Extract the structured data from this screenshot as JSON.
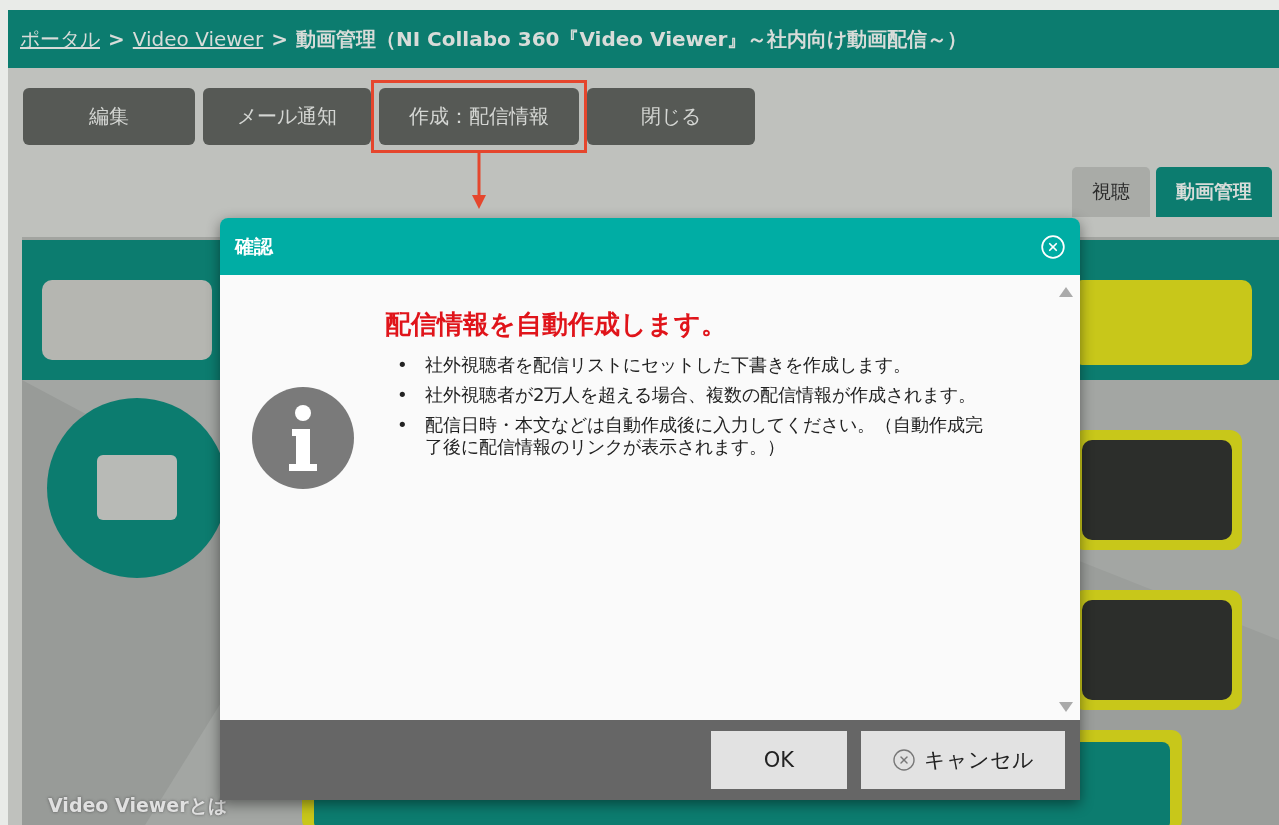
{
  "breadcrumb": [
    {
      "label": "ポータル",
      "kind": "link"
    },
    {
      "label": ">",
      "kind": "separator"
    },
    {
      "label": "Video Viewer",
      "kind": "link"
    },
    {
      "label": ">",
      "kind": "separator"
    },
    {
      "label": "動画管理（NI Collabo 360『Video Viewer』～社内向け動画配信～）",
      "kind": "current"
    }
  ],
  "toolbar": [
    {
      "label": "編集",
      "highlighted": false
    },
    {
      "label": "メール通知",
      "highlighted": false
    },
    {
      "label": "作成：配信情報",
      "highlighted": true
    },
    {
      "label": "閉じる",
      "highlighted": false
    }
  ],
  "view_tabs": [
    {
      "label": "視聴",
      "selected": false
    },
    {
      "label": "動画管理",
      "selected": true
    }
  ],
  "video": {
    "kind": "picture",
    "caption": "Video Viewerとは"
  },
  "dialog": {
    "title": "確認",
    "heading": "配信情報を自動作成します。",
    "bullets": [
      {
        "marker": "•",
        "text": "社外視聴者を配信リストにセットした下書きを作成します。"
      },
      {
        "marker": "•",
        "text": "社外視聴者が2万人を超える場合、複数の配信情報が作成されます。"
      },
      {
        "marker": "•",
        "text": "配信日時・本文などは自動作成後に入力してください。（自動作成完了後に配信情報のリンクが表示されます。）"
      }
    ],
    "buttons": [
      {
        "label": "OK",
        "kind": "ok"
      },
      {
        "label": "キャンセル",
        "kind": "cancel"
      }
    ]
  }
}
